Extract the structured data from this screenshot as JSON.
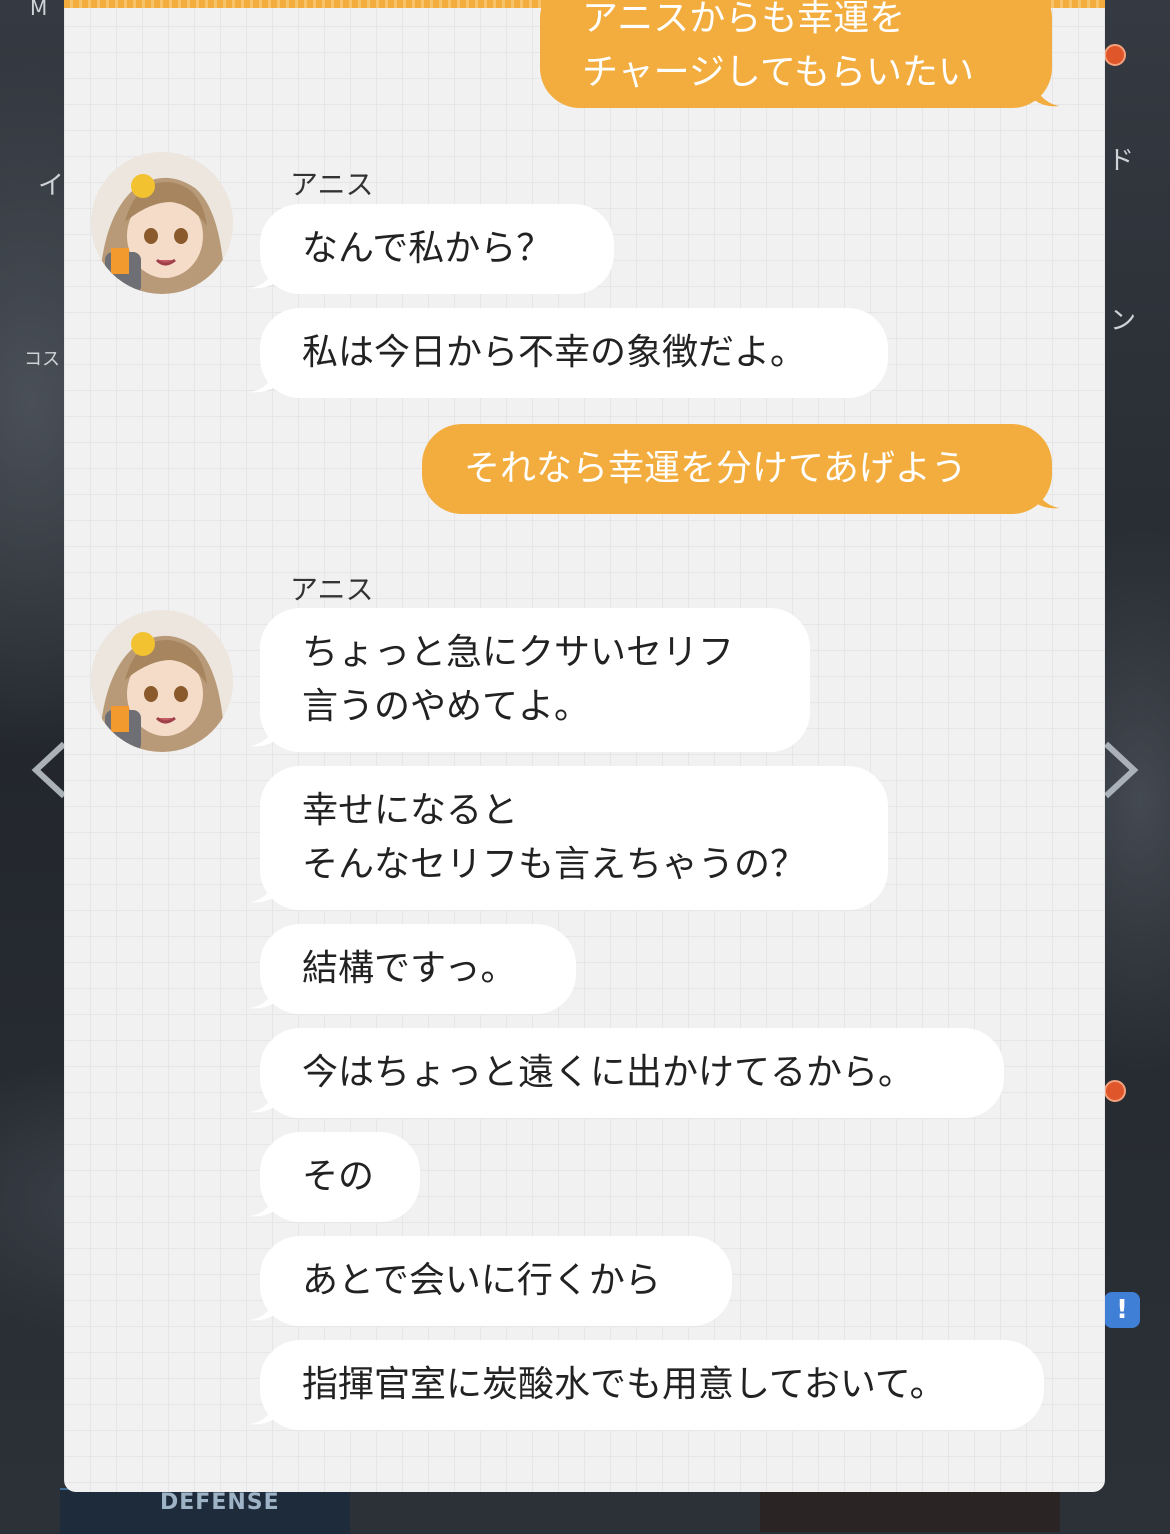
{
  "background": {
    "fragments": [
      "M",
      "イ",
      "コスト",
      "ド",
      "ン"
    ],
    "bottom_label": "DEFENSE",
    "alert_icon": "!"
  },
  "chat": {
    "accent_color": "#f2ad3e",
    "messages": [
      {
        "sender": "me",
        "lines": [
          "アニスからも幸運を",
          "チャージしてもらいたい"
        ]
      },
      {
        "sender": "npc",
        "name": "アニス",
        "text": "なんで私から？"
      },
      {
        "sender": "npc",
        "text": "私は今日から不幸の象徴だよ。"
      },
      {
        "sender": "me",
        "text": "それなら幸運を分けてあげよう"
      },
      {
        "sender": "npc",
        "name": "アニス",
        "lines": [
          "ちょっと急にクサいセリフ",
          "言うのやめてよ。"
        ]
      },
      {
        "sender": "npc",
        "lines": [
          "幸せになると",
          "そんなセリフも言えちゃうの？"
        ]
      },
      {
        "sender": "npc",
        "text": "結構ですっ。"
      },
      {
        "sender": "npc",
        "text": "今はちょっと遠くに出かけてるから。"
      },
      {
        "sender": "npc",
        "text": "その"
      },
      {
        "sender": "npc",
        "text": "あとで会いに行くから"
      },
      {
        "sender": "npc",
        "text": "指揮官室に炭酸水でも用意しておいて。"
      }
    ]
  }
}
